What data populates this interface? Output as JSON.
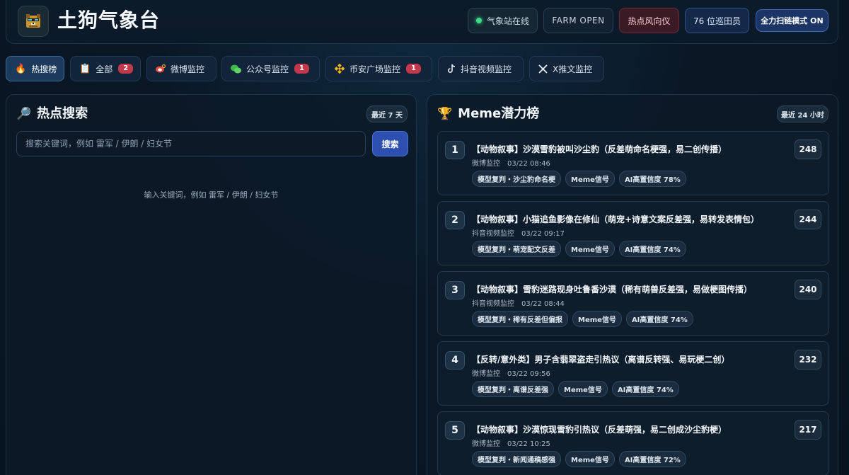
{
  "header": {
    "title": "土狗气象台",
    "logo_icon": "dog-pixel-icon",
    "status_online": "气象站在线",
    "farm": "FARM OPEN",
    "hot_wind": "热点风向仪",
    "patrol": "76 位巡田员",
    "scan_mode": "全力扫链模式 ON"
  },
  "tabs": [
    {
      "icon": "fire-icon",
      "label": "热搜榜",
      "active": true
    },
    {
      "icon": "clipboard-icon",
      "label": "全部",
      "badge": "2"
    },
    {
      "icon": "weibo-icon",
      "label": "微博监控"
    },
    {
      "icon": "wechat-icon",
      "label": "公众号监控",
      "badge": "1"
    },
    {
      "icon": "binance-icon",
      "label": "币安广场监控",
      "badge": "1"
    },
    {
      "icon": "tiktok-icon",
      "label": "抖音视频监控"
    },
    {
      "icon": "x-icon",
      "label": "X推文监控"
    }
  ],
  "search_panel": {
    "title": "热点搜索",
    "range": "最近 7 天",
    "placeholder": "搜索关键词，例如 雷军 / 伊朗 / 妇女节",
    "button": "搜索",
    "empty_hint": "输入关键词，例如 雷军 / 伊朗 / 妇女节"
  },
  "meme_panel": {
    "title": "Meme潜力榜",
    "range": "最近 24 小时",
    "items": [
      {
        "rank": "1",
        "title": "【动物叙事】沙漠雪豹被叫沙尘豹（反差萌命名梗强，易二创传播）",
        "source": "微博监控",
        "time": "03/22 08:46",
        "tags": [
          "模型复判・沙尘豹命名梗",
          "Meme信号",
          "AI高置信度 78%"
        ],
        "score": "248"
      },
      {
        "rank": "2",
        "title": "【动物叙事】小猫追鱼影像在修仙（萌宠+诗意文案反差强，易转发表情包）",
        "source": "抖音视频监控",
        "time": "03/22 09:17",
        "tags": [
          "模型复判・萌宠配文反差",
          "Meme信号",
          "AI高置信度 74%"
        ],
        "score": "244"
      },
      {
        "rank": "3",
        "title": "【动物叙事】雪豹迷路现身吐鲁番沙漠（稀有萌兽反差强，易做梗图传播）",
        "source": "抖音视频监控",
        "time": "03/22 08:44",
        "tags": [
          "模型复判・稀有反差但偏报",
          "Meme信号",
          "AI高置信度 74%"
        ],
        "score": "240"
      },
      {
        "rank": "4",
        "title": "【反转/意外类】男子含翡翠盗走引热议（离谱反转强、易玩梗二创）",
        "source": "微博监控",
        "time": "03/22 09:56",
        "tags": [
          "模型复判・离谱反差强",
          "Meme信号",
          "AI高置信度 74%"
        ],
        "score": "232"
      },
      {
        "rank": "5",
        "title": "【动物叙事】沙漠惊现雪豹引热议（反差萌强，易二创成沙尘豹梗）",
        "source": "微博监控",
        "time": "03/22 10:25",
        "tags": [
          "模型复判・新闻通稿感强",
          "Meme信号",
          "AI高置信度 72%"
        ],
        "score": "217"
      }
    ]
  }
}
